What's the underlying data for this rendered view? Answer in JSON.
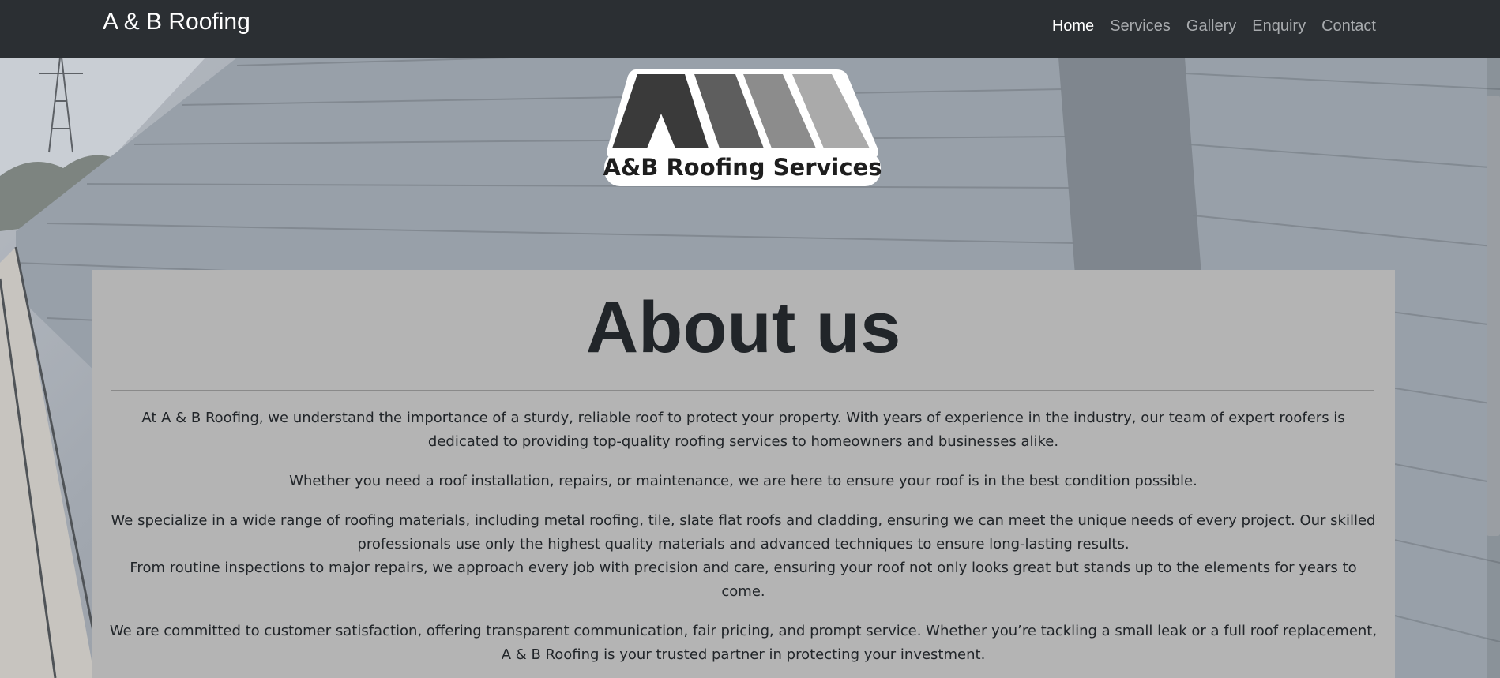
{
  "navbar": {
    "brand": "A & B Roofing",
    "links": [
      {
        "label": "Home",
        "active": true
      },
      {
        "label": "Services",
        "active": false
      },
      {
        "label": "Gallery",
        "active": false
      },
      {
        "label": "Enquiry",
        "active": false
      },
      {
        "label": "Contact",
        "active": false
      }
    ]
  },
  "logo": {
    "text": "A&B Roofing Services",
    "colors": [
      "#3a3a3a",
      "#5e5e5e",
      "#8c8c8c",
      "#aaaaaa"
    ]
  },
  "about": {
    "heading": "About us",
    "paragraphs": [
      "At A & B Roofing, we understand the importance of a sturdy, reliable roof to protect your property. With years of experience in the industry, our team of expert roofers is dedicated to providing top-quality roofing services to homeowners and businesses alike.",
      "Whether you need a roof installation, repairs, or maintenance, we are here to ensure your roof is in the best condition possible.",
      "We specialize in a wide range of roofing materials, including metal roofing, tile, slate flat roofs and cladding, ensuring we can meet the unique needs of every project. Our skilled professionals use only the highest quality materials and advanced techniques to ensure long-lasting results.",
      "From routine inspections to major repairs, we approach every job with precision and care, ensuring your roof not only looks great but stands up to the elements for years to come.",
      "We are committed to customer satisfaction, offering transparent communication, fair pricing, and prompt service. Whether you’re tackling a small leak or a full roof replacement, A & B Roofing is your trusted partner in protecting your investment."
    ]
  },
  "colors": {
    "navbar_bg": "#2b2f33",
    "panel_bg": "#b4b4b4",
    "text": "#212529"
  }
}
